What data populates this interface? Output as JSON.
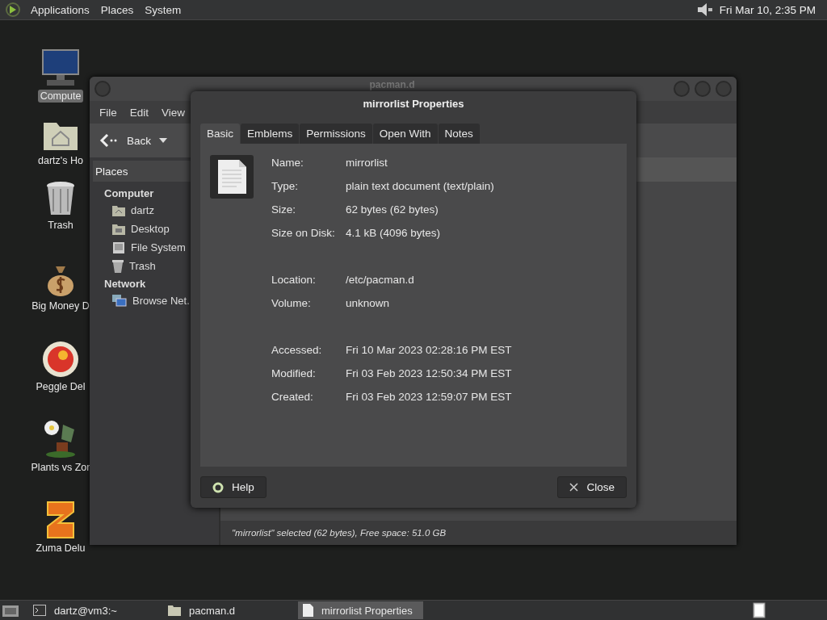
{
  "top_panel": {
    "menus": [
      "Applications",
      "Places",
      "System"
    ],
    "clock": "Fri Mar 10,  2:35 PM"
  },
  "desktop_icons": [
    {
      "label": "Compute",
      "kind": "computer",
      "selected": true
    },
    {
      "label": "dartz's Ho",
      "kind": "home",
      "selected": false
    },
    {
      "label": "Trash",
      "kind": "trash",
      "selected": false
    },
    {
      "label": "Big Money D",
      "kind": "money",
      "selected": false
    },
    {
      "label": "Peggle Del",
      "kind": "ball",
      "selected": false
    },
    {
      "label": "Plants vs Zor",
      "kind": "plant",
      "selected": false
    },
    {
      "label": "Zuma Delu",
      "kind": "block",
      "selected": false
    }
  ],
  "file_manager": {
    "title": "pacman.d",
    "menus": [
      "File",
      "Edit",
      "View"
    ],
    "back_button": "Back",
    "places_dropdown": "Places",
    "sidebar": [
      {
        "label": "Computer",
        "children": [
          {
            "label": "dartz",
            "kind": "home"
          },
          {
            "label": "Desktop",
            "kind": "desktop"
          },
          {
            "label": "File System",
            "kind": "drive"
          },
          {
            "label": "Trash",
            "kind": "trash"
          }
        ]
      },
      {
        "label": "Network",
        "children": [
          {
            "label": "Browse Net.",
            "kind": "network"
          }
        ]
      }
    ],
    "status_bar": "\"mirrorlist\" selected (62 bytes), Free space: 51.0 GB"
  },
  "dialog": {
    "title": "mirrorlist Properties",
    "tabs": [
      {
        "label": "Basic",
        "selected": true
      },
      {
        "label": "Emblems",
        "selected": false
      },
      {
        "label": "Permissions",
        "selected": false
      },
      {
        "label": "Open With",
        "selected": false
      },
      {
        "label": "Notes",
        "selected": false
      }
    ],
    "groups": [
      [
        {
          "label": "Name:",
          "value": "mirrorlist"
        },
        {
          "label": "Type:",
          "value": "plain text document (text/plain)"
        },
        {
          "label": "Size:",
          "value": "62 bytes (62 bytes)"
        },
        {
          "label": "Size on Disk:",
          "value": "4.1 kB (4096 bytes)"
        }
      ],
      [
        {
          "label": "Location:",
          "value": "/etc/pacman.d"
        },
        {
          "label": "Volume:",
          "value": "unknown"
        }
      ],
      [
        {
          "label": "Accessed:",
          "value": "Fri 10 Mar 2023 02:28:16 PM EST"
        },
        {
          "label": "Modified:",
          "value": "Fri 03 Feb 2023 12:50:34 PM EST"
        },
        {
          "label": "Created:",
          "value": "Fri 03 Feb 2023 12:59:07 PM EST"
        }
      ]
    ],
    "help_button": "Help",
    "close_button": "Close"
  },
  "taskbar": [
    {
      "label": "dartz@vm3:~",
      "kind": "terminal",
      "selected": false
    },
    {
      "label": "pacman.d",
      "kind": "folder",
      "selected": false
    },
    {
      "label": "mirrorlist Properties",
      "kind": "document",
      "selected": true
    }
  ]
}
